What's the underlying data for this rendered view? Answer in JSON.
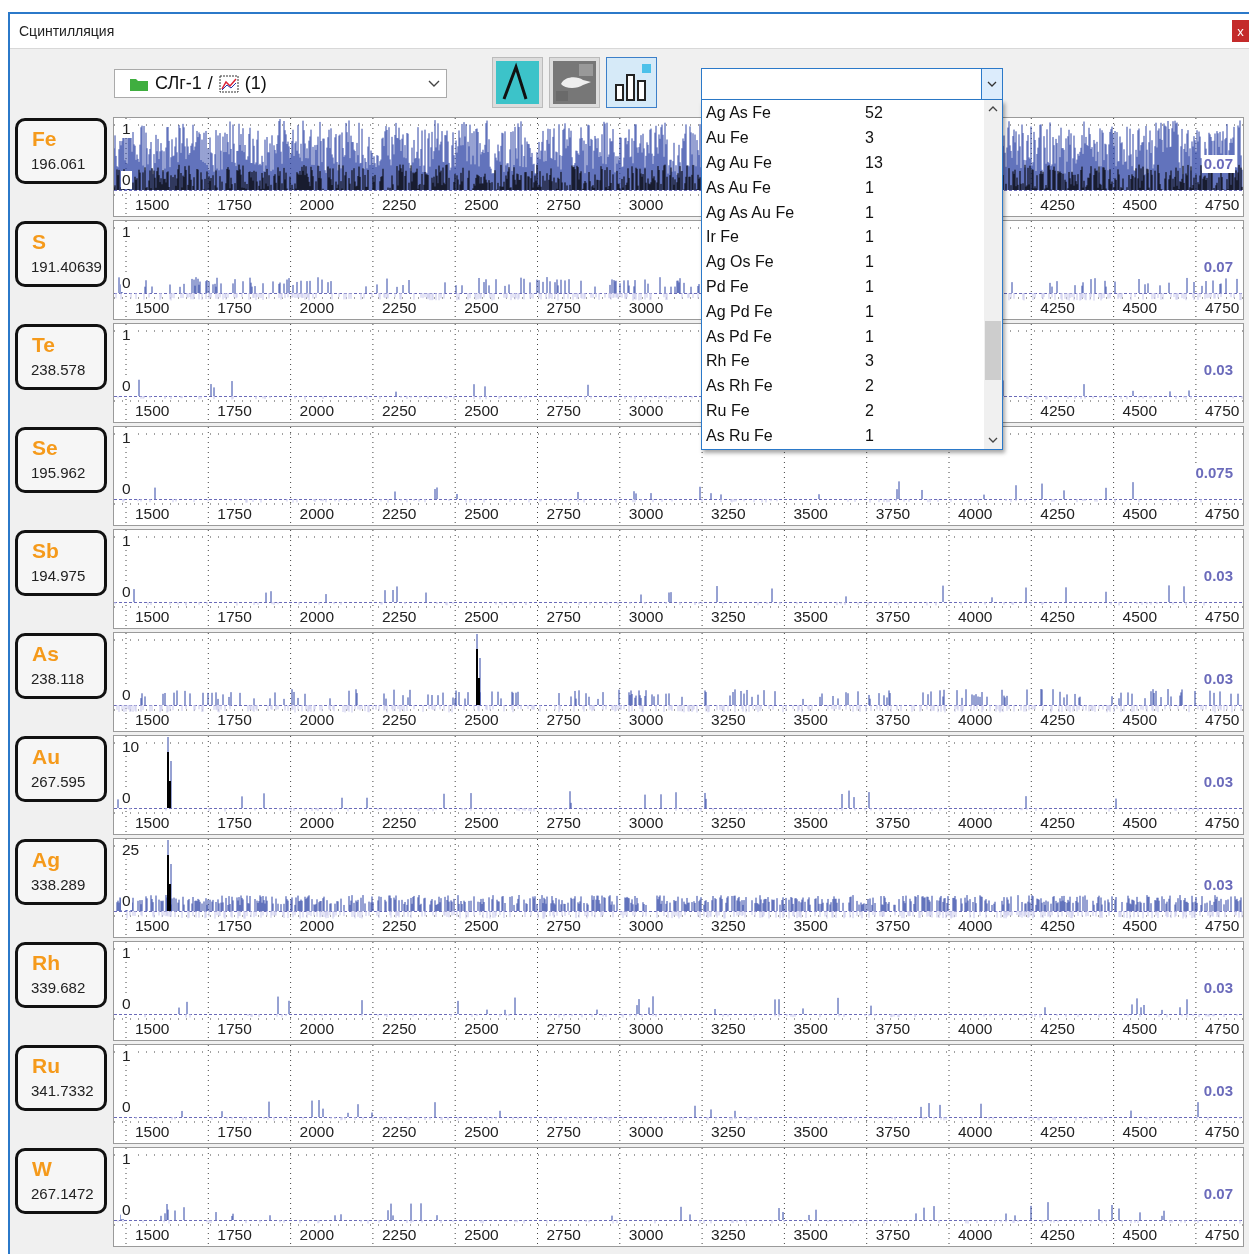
{
  "window": {
    "title": "Сцинтилляция",
    "close": "x"
  },
  "toolbar": {
    "source": {
      "folder": "СЛг-1",
      "separator": "/",
      "item": "(1)"
    },
    "view_buttons": [
      {
        "kind": "peak",
        "selected": false
      },
      {
        "kind": "image",
        "selected": false
      },
      {
        "kind": "bars",
        "selected": true
      }
    ]
  },
  "filter_dropdown": {
    "expanded": true,
    "items": [
      {
        "label": "Ag As Fe",
        "count": "52"
      },
      {
        "label": "Au Fe",
        "count": "3"
      },
      {
        "label": "Ag Au Fe",
        "count": "13"
      },
      {
        "label": "As Au Fe",
        "count": "1"
      },
      {
        "label": "Ag As Au Fe",
        "count": "1"
      },
      {
        "label": "Ir Fe",
        "count": "1"
      },
      {
        "label": "Ag Os Fe",
        "count": "1"
      },
      {
        "label": "Pd Fe",
        "count": "1"
      },
      {
        "label": "Ag Pd Fe",
        "count": "1"
      },
      {
        "label": "As Pd Fe",
        "count": "1"
      },
      {
        "label": "Rh Fe",
        "count": "3"
      },
      {
        "label": "As Rh Fe",
        "count": "2"
      },
      {
        "label": "Ru Fe",
        "count": "2"
      },
      {
        "label": "As Ru Fe",
        "count": "1"
      }
    ]
  },
  "channels": [
    {
      "element": "Fe",
      "wavelength": "196.061",
      "kind": "noise",
      "y_max": "1",
      "y_min": "0",
      "scale": "0.07",
      "x_ticks": [
        "1500",
        "1750",
        "2000",
        "2250",
        "2500",
        "2750",
        "3000",
        "4250",
        "4500",
        "4750"
      ]
    },
    {
      "element": "S",
      "wavelength": "191.40639",
      "kind": "dense",
      "y_max": "1",
      "y_min": "0",
      "scale": "0.07",
      "x_ticks": [
        "1500",
        "1750",
        "2000",
        "2250",
        "2500",
        "2750",
        "3000",
        "4250",
        "4500",
        "4750"
      ]
    },
    {
      "element": "Te",
      "wavelength": "238.578",
      "kind": "sparse",
      "y_max": "1",
      "y_min": "0",
      "scale": "0.03",
      "x_ticks": [
        "1500",
        "1750",
        "2000",
        "2250",
        "2500",
        "2750",
        "3000",
        "4250",
        "4500",
        "4750"
      ]
    },
    {
      "element": "Se",
      "wavelength": "195.962",
      "kind": "sparse",
      "y_max": "1",
      "y_min": "0",
      "scale": "0.075",
      "x_ticks": [
        "1500",
        "1750",
        "2000",
        "2250",
        "2500",
        "2750",
        "3000",
        "3250",
        "3500",
        "3750",
        "4000",
        "4250",
        "4500",
        "4750"
      ]
    },
    {
      "element": "Sb",
      "wavelength": "194.975",
      "kind": "sparse",
      "y_max": "1",
      "y_min": "0",
      "scale": "0.03",
      "x_ticks": [
        "1500",
        "1750",
        "2000",
        "2250",
        "2500",
        "2750",
        "3000",
        "3250",
        "3500",
        "3750",
        "4000",
        "4250",
        "4500",
        "4750"
      ]
    },
    {
      "element": "As",
      "wavelength": "238.118",
      "kind": "dense",
      "y_min": "0",
      "scale": "0.03",
      "x_ticks": [
        "1500",
        "1750",
        "2000",
        "2250",
        "2500",
        "2750",
        "3000",
        "3250",
        "3500",
        "3750",
        "4000",
        "4250",
        "4500",
        "4750"
      ]
    },
    {
      "element": "Au",
      "wavelength": "267.595",
      "kind": "sparse",
      "y_max": "10",
      "y_min": "0",
      "scale": "0.03",
      "x_ticks": [
        "1500",
        "1750",
        "2000",
        "2250",
        "2500",
        "2750",
        "3000",
        "3250",
        "3500",
        "3750",
        "4000",
        "4250",
        "4500",
        "4750"
      ]
    },
    {
      "element": "Ag",
      "wavelength": "338.289",
      "kind": "dense",
      "y_max": "25",
      "y_min": "0",
      "scale": "0.03",
      "x_ticks": [
        "1500",
        "1750",
        "2000",
        "2250",
        "2500",
        "2750",
        "3000",
        "3250",
        "3500",
        "3750",
        "4000",
        "4250",
        "4500",
        "4750"
      ]
    },
    {
      "element": "Rh",
      "wavelength": "339.682",
      "kind": "sparse",
      "y_max": "1",
      "y_min": "0",
      "scale": "0.03",
      "x_ticks": [
        "1500",
        "1750",
        "2000",
        "2250",
        "2500",
        "2750",
        "3000",
        "3250",
        "3500",
        "3750",
        "4000",
        "4250",
        "4500",
        "4750"
      ]
    },
    {
      "element": "Ru",
      "wavelength": "341.7332",
      "kind": "sparse",
      "y_max": "1",
      "y_min": "0",
      "scale": "0.03",
      "x_ticks": [
        "1500",
        "1750",
        "2000",
        "2250",
        "2500",
        "2750",
        "3000",
        "3250",
        "3500",
        "3750",
        "4000",
        "4250",
        "4500",
        "4750"
      ]
    },
    {
      "element": "W",
      "wavelength": "267.1472",
      "kind": "sparse",
      "y_max": "1",
      "y_min": "0",
      "scale": "0.07",
      "x_ticks": [
        "1500",
        "1750",
        "2000",
        "2250",
        "2500",
        "2750",
        "3000",
        "3250",
        "3500",
        "3750",
        "4000",
        "4250",
        "4500",
        "4750"
      ]
    }
  ]
}
